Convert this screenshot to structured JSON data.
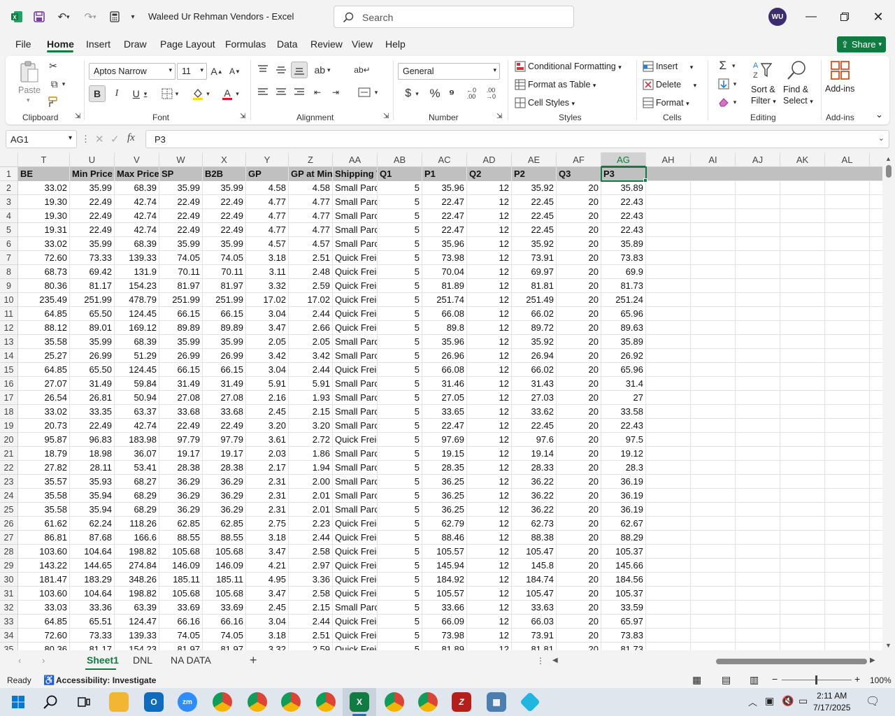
{
  "window": {
    "title": "Waleed Ur Rehman Vendors  -  Excel",
    "search_placeholder": "Search",
    "avatar_initials": "WU"
  },
  "menu": [
    "File",
    "Home",
    "Insert",
    "Draw",
    "Page Layout",
    "Formulas",
    "Data",
    "Review",
    "View",
    "Help"
  ],
  "share_label": "Share",
  "ribbon": {
    "clipboard": {
      "paste": "Paste",
      "label": "Clipboard"
    },
    "font": {
      "name": "Aptos Narrow",
      "size": "11",
      "label": "Font"
    },
    "alignment": {
      "label": "Alignment"
    },
    "number": {
      "format": "General",
      "label": "Number"
    },
    "styles": {
      "conditional": "Conditional Formatting",
      "table": "Format as Table",
      "cell": "Cell Styles",
      "label": "Styles"
    },
    "cells": {
      "insert": "Insert",
      "delete": "Delete",
      "format": "Format",
      "label": "Cells"
    },
    "editing": {
      "sort1": "Sort &",
      "sort2": "Filter",
      "find1": "Find &",
      "find2": "Select",
      "label": "Editing"
    },
    "addins": {
      "btn": "Add-ins",
      "label": "Add-ins"
    }
  },
  "formula_bar": {
    "name_box": "AG1",
    "content": "P3"
  },
  "columns": [
    "T",
    "U",
    "V",
    "W",
    "X",
    "Y",
    "Z",
    "AA",
    "AB",
    "AC",
    "AD",
    "AE",
    "AF",
    "AG",
    "AH",
    "AI",
    "AJ",
    "AK",
    "AL"
  ],
  "header_row": [
    "BE",
    "Min Price",
    "Max Price",
    "SP",
    "B2B",
    "GP",
    "GP at Min",
    "Shipping T",
    "Q1",
    "P1",
    "Q2",
    "P2",
    "Q3",
    "P3"
  ],
  "rows": [
    [
      "33.02",
      "35.99",
      "68.39",
      "35.99",
      "35.99",
      "4.58",
      "4.58",
      "Small Parcel",
      "5",
      "35.96",
      "12",
      "35.92",
      "20",
      "35.89"
    ],
    [
      "19.30",
      "22.49",
      "42.74",
      "22.49",
      "22.49",
      "4.77",
      "4.77",
      "Small Parcel",
      "5",
      "22.47",
      "12",
      "22.45",
      "20",
      "22.43"
    ],
    [
      "19.30",
      "22.49",
      "42.74",
      "22.49",
      "22.49",
      "4.77",
      "4.77",
      "Small Parcel",
      "5",
      "22.47",
      "12",
      "22.45",
      "20",
      "22.43"
    ],
    [
      "19.31",
      "22.49",
      "42.74",
      "22.49",
      "22.49",
      "4.77",
      "4.77",
      "Small Parcel",
      "5",
      "22.47",
      "12",
      "22.45",
      "20",
      "22.43"
    ],
    [
      "33.02",
      "35.99",
      "68.39",
      "35.99",
      "35.99",
      "4.57",
      "4.57",
      "Small Parcel",
      "5",
      "35.96",
      "12",
      "35.92",
      "20",
      "35.89"
    ],
    [
      "72.60",
      "73.33",
      "139.33",
      "74.05",
      "74.05",
      "3.18",
      "2.51",
      "Quick Freight",
      "5",
      "73.98",
      "12",
      "73.91",
      "20",
      "73.83"
    ],
    [
      "68.73",
      "69.42",
      "131.9",
      "70.11",
      "70.11",
      "3.11",
      "2.48",
      "Quick Freight",
      "5",
      "70.04",
      "12",
      "69.97",
      "20",
      "69.9"
    ],
    [
      "80.36",
      "81.17",
      "154.23",
      "81.97",
      "81.97",
      "3.32",
      "2.59",
      "Quick Freight",
      "5",
      "81.89",
      "12",
      "81.81",
      "20",
      "81.73"
    ],
    [
      "235.49",
      "251.99",
      "478.79",
      "251.99",
      "251.99",
      "17.02",
      "17.02",
      "Quick Freight",
      "5",
      "251.74",
      "12",
      "251.49",
      "20",
      "251.24"
    ],
    [
      "64.85",
      "65.50",
      "124.45",
      "66.15",
      "66.15",
      "3.04",
      "2.44",
      "Quick Freight",
      "5",
      "66.08",
      "12",
      "66.02",
      "20",
      "65.96"
    ],
    [
      "88.12",
      "89.01",
      "169.12",
      "89.89",
      "89.89",
      "3.47",
      "2.66",
      "Quick Freight",
      "5",
      "89.8",
      "12",
      "89.72",
      "20",
      "89.63"
    ],
    [
      "35.58",
      "35.99",
      "68.39",
      "35.99",
      "35.99",
      "2.05",
      "2.05",
      "Small Parcel",
      "5",
      "35.96",
      "12",
      "35.92",
      "20",
      "35.89"
    ],
    [
      "25.27",
      "26.99",
      "51.29",
      "26.99",
      "26.99",
      "3.42",
      "3.42",
      "Small Parcel",
      "5",
      "26.96",
      "12",
      "26.94",
      "20",
      "26.92"
    ],
    [
      "64.85",
      "65.50",
      "124.45",
      "66.15",
      "66.15",
      "3.04",
      "2.44",
      "Quick Freight",
      "5",
      "66.08",
      "12",
      "66.02",
      "20",
      "65.96"
    ],
    [
      "27.07",
      "31.49",
      "59.84",
      "31.49",
      "31.49",
      "5.91",
      "5.91",
      "Small Parcel",
      "5",
      "31.46",
      "12",
      "31.43",
      "20",
      "31.4"
    ],
    [
      "26.54",
      "26.81",
      "50.94",
      "27.08",
      "27.08",
      "2.16",
      "1.93",
      "Small Parcel",
      "5",
      "27.05",
      "12",
      "27.03",
      "20",
      "27"
    ],
    [
      "33.02",
      "33.35",
      "63.37",
      "33.68",
      "33.68",
      "2.45",
      "2.15",
      "Small Parcel",
      "5",
      "33.65",
      "12",
      "33.62",
      "20",
      "33.58"
    ],
    [
      "20.73",
      "22.49",
      "42.74",
      "22.49",
      "22.49",
      "3.20",
      "3.20",
      "Small Parcel",
      "5",
      "22.47",
      "12",
      "22.45",
      "20",
      "22.43"
    ],
    [
      "95.87",
      "96.83",
      "183.98",
      "97.79",
      "97.79",
      "3.61",
      "2.72",
      "Quick Freight",
      "5",
      "97.69",
      "12",
      "97.6",
      "20",
      "97.5"
    ],
    [
      "18.79",
      "18.98",
      "36.07",
      "19.17",
      "19.17",
      "2.03",
      "1.86",
      "Small Parcel",
      "5",
      "19.15",
      "12",
      "19.14",
      "20",
      "19.12"
    ],
    [
      "27.82",
      "28.11",
      "53.41",
      "28.38",
      "28.38",
      "2.17",
      "1.94",
      "Small Parcel",
      "5",
      "28.35",
      "12",
      "28.33",
      "20",
      "28.3"
    ],
    [
      "35.57",
      "35.93",
      "68.27",
      "36.29",
      "36.29",
      "2.31",
      "2.00",
      "Small Parcel",
      "5",
      "36.25",
      "12",
      "36.22",
      "20",
      "36.19"
    ],
    [
      "35.58",
      "35.94",
      "68.29",
      "36.29",
      "36.29",
      "2.31",
      "2.01",
      "Small Parcel",
      "5",
      "36.25",
      "12",
      "36.22",
      "20",
      "36.19"
    ],
    [
      "35.58",
      "35.94",
      "68.29",
      "36.29",
      "36.29",
      "2.31",
      "2.01",
      "Small Parcel",
      "5",
      "36.25",
      "12",
      "36.22",
      "20",
      "36.19"
    ],
    [
      "61.62",
      "62.24",
      "118.26",
      "62.85",
      "62.85",
      "2.75",
      "2.23",
      "Quick Freight",
      "5",
      "62.79",
      "12",
      "62.73",
      "20",
      "62.67"
    ],
    [
      "86.81",
      "87.68",
      "166.6",
      "88.55",
      "88.55",
      "3.18",
      "2.44",
      "Quick Freight",
      "5",
      "88.46",
      "12",
      "88.38",
      "20",
      "88.29"
    ],
    [
      "103.60",
      "104.64",
      "198.82",
      "105.68",
      "105.68",
      "3.47",
      "2.58",
      "Quick Freight",
      "5",
      "105.57",
      "12",
      "105.47",
      "20",
      "105.37"
    ],
    [
      "143.22",
      "144.65",
      "274.84",
      "146.09",
      "146.09",
      "4.21",
      "2.97",
      "Quick Freight",
      "5",
      "145.94",
      "12",
      "145.8",
      "20",
      "145.66"
    ],
    [
      "181.47",
      "183.29",
      "348.26",
      "185.11",
      "185.11",
      "4.95",
      "3.36",
      "Quick Freight",
      "5",
      "184.92",
      "12",
      "184.74",
      "20",
      "184.56"
    ],
    [
      "103.60",
      "104.64",
      "198.82",
      "105.68",
      "105.68",
      "3.47",
      "2.58",
      "Quick Freight",
      "5",
      "105.57",
      "12",
      "105.47",
      "20",
      "105.37"
    ],
    [
      "33.03",
      "33.36",
      "63.39",
      "33.69",
      "33.69",
      "2.45",
      "2.15",
      "Small Parcel",
      "5",
      "33.66",
      "12",
      "33.63",
      "20",
      "33.59"
    ],
    [
      "64.85",
      "65.51",
      "124.47",
      "66.16",
      "66.16",
      "3.04",
      "2.44",
      "Quick Freight",
      "5",
      "66.09",
      "12",
      "66.03",
      "20",
      "65.97"
    ],
    [
      "72.60",
      "73.33",
      "139.33",
      "74.05",
      "74.05",
      "3.18",
      "2.51",
      "Quick Freight",
      "5",
      "73.98",
      "12",
      "73.91",
      "20",
      "73.83"
    ],
    [
      "80.36",
      "81.17",
      "154.23",
      "81.97",
      "81.97",
      "3.32",
      "2.59",
      "Quick Freight",
      "5",
      "81.89",
      "12",
      "81.81",
      "20",
      "81.73"
    ]
  ],
  "sheet_tabs": [
    "Sheet1",
    "DNL",
    "NA DATA"
  ],
  "status": {
    "ready": "Ready",
    "accessibility": "Accessibility: Investigate",
    "zoom": "100%"
  },
  "taskbar": {
    "time": "2:11 AM",
    "date": "7/17/2025"
  }
}
